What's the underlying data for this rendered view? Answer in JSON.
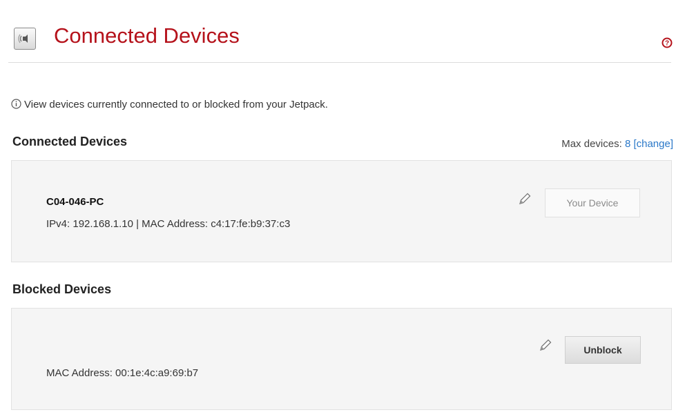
{
  "header": {
    "title": "Connected Devices",
    "icon": "speaker-icon",
    "help_icon": "help-icon",
    "title_color": "#b5121b"
  },
  "info": {
    "text": "View devices currently connected to or blocked from your Jetpack."
  },
  "connected": {
    "section_title": "Connected Devices",
    "max_devices_label": "Max devices:",
    "max_devices_value": "8",
    "change_link": "[change]",
    "devices": [
      {
        "name": "C04-046-PC",
        "details": "IPv4: 192.168.1.10 | MAC Address: c4:17:fe:b9:37:c3",
        "button_label": "Your Device"
      }
    ]
  },
  "blocked": {
    "section_title": "Blocked Devices",
    "devices": [
      {
        "details": "MAC Address: 00:1e:4c:a9:69:b7",
        "button_label": "Unblock"
      }
    ]
  },
  "colors": {
    "accent": "#b5121b",
    "link": "#2a78c8",
    "panel_bg": "#f5f5f5"
  }
}
